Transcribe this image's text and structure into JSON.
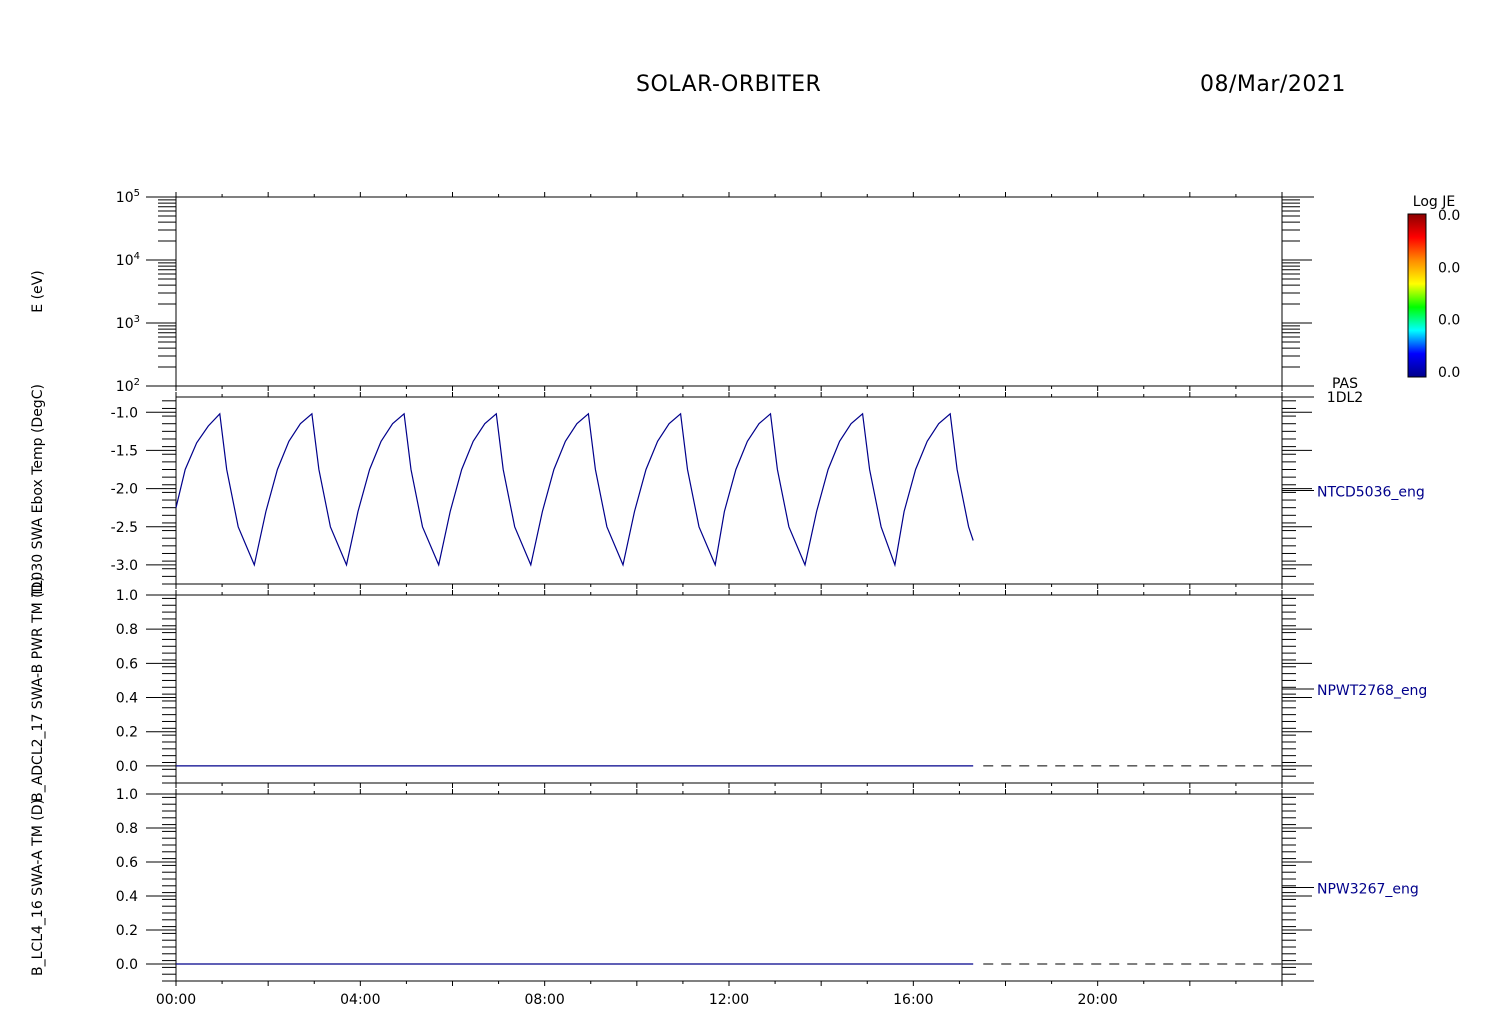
{
  "header": {
    "mission": "SOLAR-ORBITER",
    "date": "08/Mar/2021"
  },
  "colorbar": {
    "title": "Log JE",
    "labels": [
      "0.0",
      "0.0",
      "0.0",
      "0.0"
    ],
    "colors": [
      "#8b0000",
      "#ff0000",
      "#ff8c00",
      "#ffff00",
      "#00ff00",
      "#00ffff",
      "#0000ff",
      "#00008b"
    ]
  },
  "x_axis": {
    "tick_labels": [
      "00:00",
      "04:00",
      "08:00",
      "12:00",
      "16:00",
      "20:00"
    ],
    "tick_hours": [
      0,
      4,
      8,
      12,
      16,
      20
    ],
    "range_hours": [
      0,
      24
    ]
  },
  "line_color": "#00008b",
  "chart_data": [
    {
      "type": "heatmap",
      "ylabel": "E (eV)",
      "yscale": "log",
      "ylim": [
        100,
        100000
      ],
      "ytick_bases": [
        "10",
        "10",
        "10",
        "10"
      ],
      "ytick_exponents": [
        "2",
        "3",
        "4",
        "5"
      ],
      "right_labels": [
        "PAS",
        "1DL2"
      ],
      "values": []
    },
    {
      "type": "line",
      "ylabel": "TL030 SWA Ebox Temp (DegC)",
      "series_label": "NTCD5036_eng",
      "ylim": [
        -3.25,
        -0.8
      ],
      "yticks": [
        -3.0,
        -2.5,
        -2.0,
        -1.5,
        -1.0
      ],
      "ytick_labels": [
        "-3.0",
        "-2.5",
        "-2.0",
        "-1.5",
        "-1.0"
      ],
      "x": [
        0.0,
        0.2,
        0.45,
        0.7,
        0.95,
        1.1,
        1.35,
        1.7,
        1.95,
        2.2,
        2.45,
        2.7,
        2.95,
        3.1,
        3.35,
        3.7,
        3.95,
        4.2,
        4.45,
        4.7,
        4.95,
        5.1,
        5.35,
        5.7,
        5.95,
        6.2,
        6.45,
        6.7,
        6.95,
        7.1,
        7.35,
        7.7,
        7.95,
        8.2,
        8.45,
        8.7,
        8.95,
        9.1,
        9.35,
        9.7,
        9.95,
        10.2,
        10.45,
        10.7,
        10.95,
        11.1,
        11.35,
        11.7,
        11.9,
        12.15,
        12.4,
        12.65,
        12.9,
        13.05,
        13.3,
        13.65,
        13.9,
        14.15,
        14.4,
        14.65,
        14.9,
        15.05,
        15.3,
        15.6,
        15.8,
        16.05,
        16.3,
        16.55,
        16.8,
        16.95,
        17.2,
        17.3
      ],
      "y": [
        -2.25,
        -1.75,
        -1.4,
        -1.18,
        -1.02,
        -1.75,
        -2.5,
        -3.0,
        -2.3,
        -1.75,
        -1.38,
        -1.15,
        -1.02,
        -1.75,
        -2.5,
        -3.0,
        -2.3,
        -1.75,
        -1.38,
        -1.15,
        -1.02,
        -1.75,
        -2.5,
        -3.0,
        -2.3,
        -1.75,
        -1.38,
        -1.15,
        -1.02,
        -1.75,
        -2.5,
        -3.0,
        -2.3,
        -1.75,
        -1.38,
        -1.15,
        -1.02,
        -1.75,
        -2.5,
        -3.0,
        -2.3,
        -1.75,
        -1.38,
        -1.15,
        -1.02,
        -1.75,
        -2.5,
        -3.0,
        -2.3,
        -1.75,
        -1.38,
        -1.15,
        -1.02,
        -1.75,
        -2.5,
        -3.0,
        -2.3,
        -1.75,
        -1.38,
        -1.15,
        -1.02,
        -1.75,
        -2.5,
        -3.0,
        -2.3,
        -1.75,
        -1.38,
        -1.15,
        -1.02,
        -1.75,
        -2.5,
        -2.68
      ]
    },
    {
      "type": "line",
      "ylabel": "B_ADCL2_17 SWA-B PWR TM (D)",
      "series_label": "NPWT2768_eng",
      "ylim": [
        -0.1,
        1.0
      ],
      "yticks": [
        0.0,
        0.2,
        0.4,
        0.6,
        0.8,
        1.0
      ],
      "ytick_labels": [
        "0.0",
        "0.2",
        "0.4",
        "0.6",
        "0.8",
        "1.0"
      ],
      "x": [
        0.0,
        17.3
      ],
      "y": [
        0.0,
        0.0
      ],
      "dashed_to": 24,
      "dashed_y": 0.0
    },
    {
      "type": "line",
      "ylabel": "B_LCL4_16 SWA-A TM (D)",
      "series_label": "NPW3267_eng",
      "ylim": [
        -0.1,
        1.0
      ],
      "yticks": [
        0.0,
        0.2,
        0.4,
        0.6,
        0.8,
        1.0
      ],
      "ytick_labels": [
        "0.0",
        "0.2",
        "0.4",
        "0.6",
        "0.8",
        "1.0"
      ],
      "x": [
        0.0,
        17.3
      ],
      "y": [
        0.0,
        0.0
      ],
      "dashed_to": 24,
      "dashed_y": 0.0
    }
  ]
}
